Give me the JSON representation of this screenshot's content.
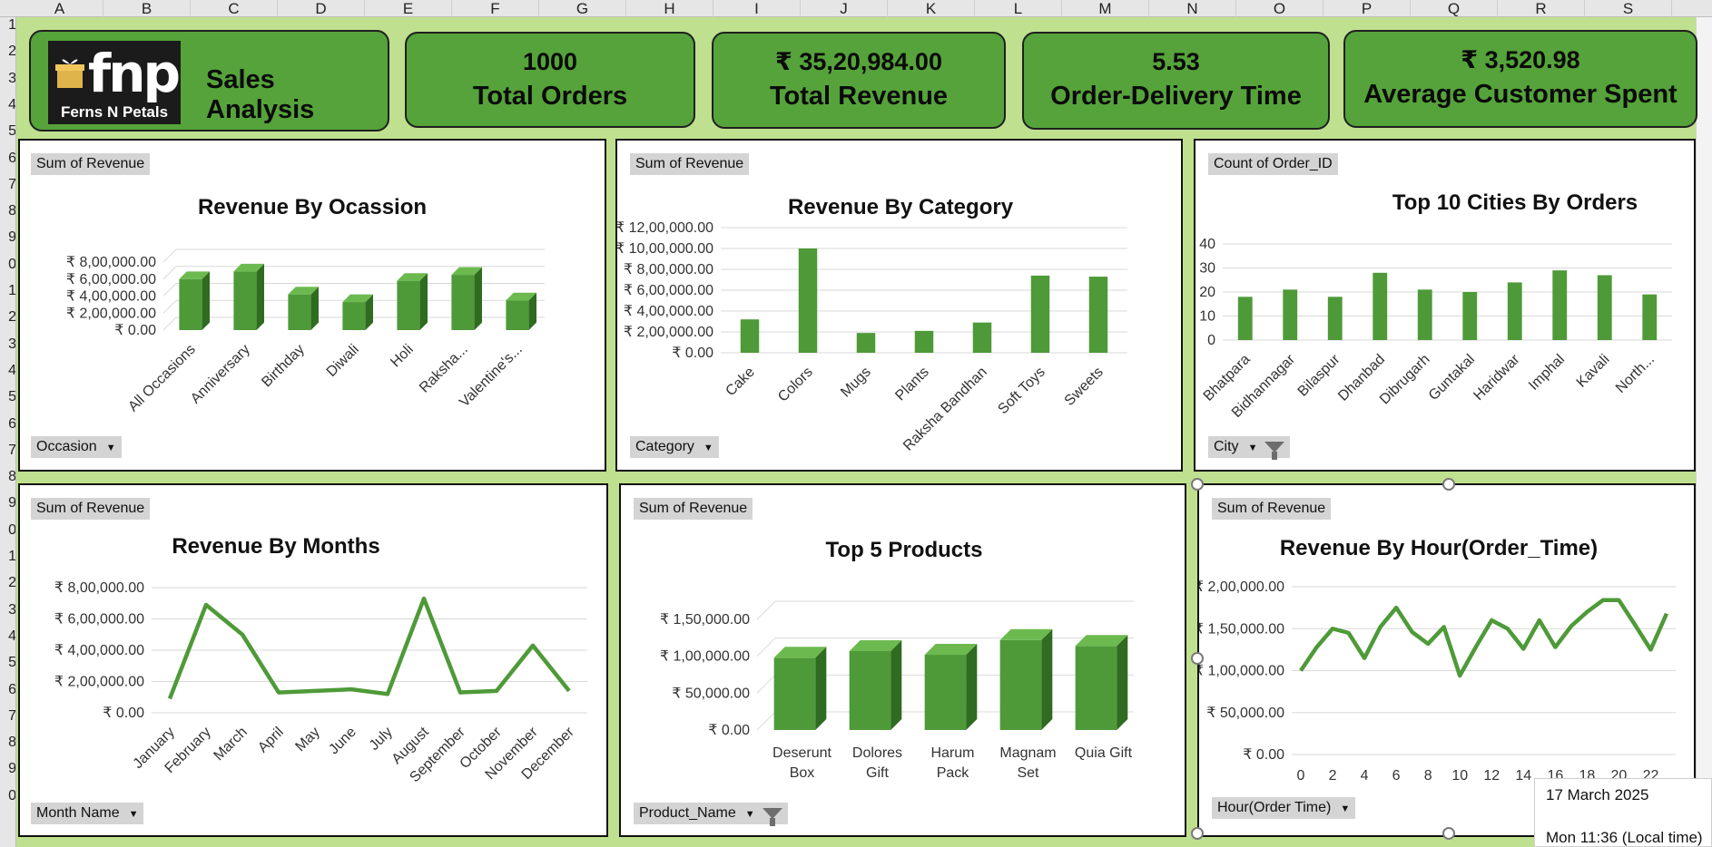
{
  "sheet": {
    "columns": [
      "A",
      "B",
      "C",
      "D",
      "E",
      "F",
      "G",
      "H",
      "I",
      "J",
      "K",
      "L",
      "M",
      "N",
      "O",
      "P",
      "Q",
      "R",
      "S"
    ],
    "rows": [
      "1",
      "2",
      "3",
      "4",
      "5",
      "6",
      "7",
      "8",
      "9",
      "0",
      "1",
      "2",
      "3",
      "4",
      "5",
      "6",
      "7",
      "8",
      "9",
      "0",
      "1",
      "2",
      "3",
      "4",
      "5",
      "6",
      "7",
      "8",
      "9",
      "0"
    ]
  },
  "header": {
    "logo_text": "fnp",
    "logo_sub": "Ferns N Petals",
    "title": "Sales Analysis"
  },
  "kpis": [
    {
      "value": "1000",
      "label": "Total Orders"
    },
    {
      "value": "₹ 35,20,984.00",
      "label": "Total Revenue"
    },
    {
      "value": "5.53",
      "label": "Order-Delivery Time"
    },
    {
      "value": "₹ 3,520.98",
      "label": "Average Customer Spent"
    }
  ],
  "colors": {
    "bar": "#4e9a38",
    "bar_dark": "#2f6b20",
    "bar_top": "#6cba4f",
    "line": "#4e9a38"
  },
  "charts": {
    "occasion": {
      "field_button": "Sum of Revenue",
      "axis_button": "Occasion",
      "chart_data": {
        "type": "bar",
        "title": "Revenue By Ocassion",
        "categories": [
          "All Occasions",
          "Anniversary",
          "Birthday",
          "Diwali",
          "Holi",
          "Raksha...",
          "Valentine's..."
        ],
        "values": [
          600000,
          690000,
          420000,
          330000,
          580000,
          650000,
          350000
        ],
        "ylim": [
          0,
          800000
        ],
        "yticks": [
          "₹ 0.00",
          "₹ 2,00,000.00",
          "₹ 4,00,000.00",
          "₹ 6,00,000.00",
          "₹ 8,00,000.00"
        ],
        "grid": true
      }
    },
    "category": {
      "field_button": "Sum of Revenue",
      "axis_button": "Category",
      "chart_data": {
        "type": "bar",
        "title": "Revenue By Category",
        "categories": [
          "Cake",
          "Colors",
          "Mugs",
          "Plants",
          "Raksha Bandhan",
          "Soft Toys",
          "Sweets"
        ],
        "values": [
          320000,
          1000000,
          190000,
          210000,
          290000,
          740000,
          730000
        ],
        "ylim": [
          0,
          1200000
        ],
        "yticks": [
          "₹ 0.00",
          "₹ 2,00,000.00",
          "₹ 4,00,000.00",
          "₹ 6,00,000.00",
          "₹ 8,00,000.00",
          "₹ 10,00,000.00",
          "₹ 12,00,000.00"
        ],
        "grid": true
      }
    },
    "cities": {
      "field_button": "Count of Order_ID",
      "axis_button": "City",
      "chart_data": {
        "type": "bar",
        "title": "Top 10 Cities By Orders",
        "categories": [
          "Bhatpara",
          "Bidhannagar",
          "Bilaspur",
          "Dhanbad",
          "Dibrugarh",
          "Guntakal",
          "Haridwar",
          "Imphal",
          "Kavali",
          "North..."
        ],
        "values": [
          18,
          21,
          18,
          28,
          21,
          20,
          24,
          29,
          27,
          19
        ],
        "ylim": [
          0,
          40
        ],
        "yticks": [
          "0",
          "10",
          "20",
          "30",
          "40"
        ],
        "grid": true
      }
    },
    "months": {
      "field_button": "Sum of Revenue",
      "axis_button": "Month Name",
      "chart_data": {
        "type": "line",
        "title": "Revenue By Months",
        "categories": [
          "January",
          "February",
          "March",
          "April",
          "May",
          "June",
          "July",
          "August",
          "September",
          "October",
          "November",
          "December"
        ],
        "values": [
          90000,
          690000,
          500000,
          130000,
          140000,
          150000,
          120000,
          730000,
          130000,
          140000,
          430000,
          140000
        ],
        "ylim": [
          0,
          800000
        ],
        "yticks": [
          "₹ 0.00",
          "₹ 2,00,000.00",
          "₹ 4,00,000.00",
          "₹ 6,00,000.00",
          "₹ 8,00,000.00"
        ],
        "grid": true
      }
    },
    "products": {
      "field_button": "Sum of Revenue",
      "axis_button": "Product_Name",
      "chart_data": {
        "type": "bar",
        "title": "Top 5 Products",
        "categories": [
          "Deserunt Box",
          "Dolores Gift",
          "Harum Pack",
          "Magnam Set",
          "Quia Gift"
        ],
        "labels": [
          [
            "Deserunt",
            "Box"
          ],
          [
            "Dolores",
            "Gift"
          ],
          [
            "Harum",
            "Pack"
          ],
          [
            "Magnam",
            "Set"
          ],
          [
            "Quia Gift"
          ]
        ],
        "values": [
          98000,
          107000,
          102000,
          122000,
          114000
        ],
        "ylim": [
          0,
          150000
        ],
        "yticks": [
          "₹ 0.00",
          "₹ 50,000.00",
          "₹ 1,00,000.00",
          "₹ 1,50,000.00"
        ],
        "grid": true
      }
    },
    "hour": {
      "field_button": "Sum of Revenue",
      "axis_button": "Hour(Order Time)",
      "chart_data": {
        "type": "line",
        "title": "Revenue By Hour(Order_Time)",
        "x": [
          0,
          1,
          2,
          3,
          4,
          5,
          6,
          7,
          8,
          9,
          10,
          11,
          12,
          13,
          14,
          15,
          16,
          17,
          18,
          19,
          20,
          21,
          22,
          23
        ],
        "xticks": [
          "0",
          "2",
          "4",
          "6",
          "8",
          "10",
          "12",
          "14",
          "16",
          "18",
          "20",
          "22"
        ],
        "values": [
          100000,
          128000,
          150000,
          145000,
          115000,
          152000,
          175000,
          146000,
          132000,
          152000,
          94000,
          128000,
          160000,
          150000,
          126000,
          160000,
          128000,
          153000,
          170000,
          184000,
          184000,
          155000,
          125000,
          168000
        ],
        "ylim": [
          0,
          200000
        ],
        "yticks": [
          "₹ 0.00",
          "₹ 50,000.00",
          "₹ 1,00,000.00",
          "₹ 1,50,000.00",
          "₹ 2,00,000.00"
        ],
        "grid": true
      }
    }
  },
  "clock": {
    "date": "17 March 2025",
    "time": "Mon 11:36 (Local time)"
  }
}
